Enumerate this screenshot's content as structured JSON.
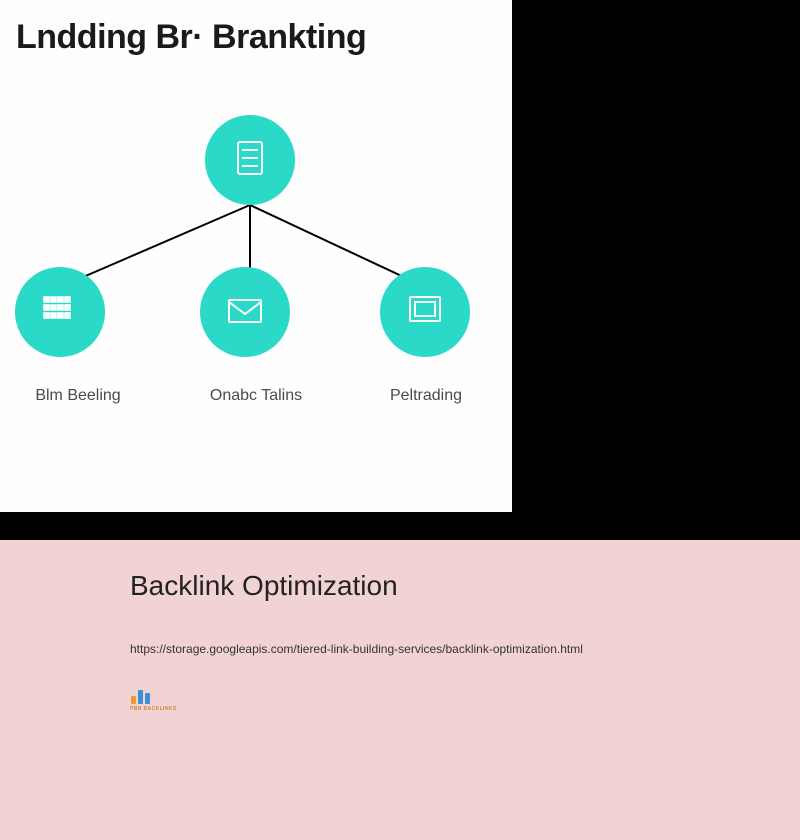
{
  "diagram": {
    "title": "Lndding Br· Brankting",
    "nodes": {
      "top": {
        "icon": "database"
      },
      "left": {
        "icon": "grid-code",
        "label": "Blm Beeling"
      },
      "middle": {
        "icon": "envelope",
        "label": "Onabc Talins"
      },
      "right": {
        "icon": "monitor",
        "label": "Peltrading"
      }
    }
  },
  "card": {
    "title": "Backlink Optimization",
    "url": "https://storage.googleapis.com/tiered-link-building-services/backlink-optimization.html",
    "logo_text": "PBN BACKLINKS"
  },
  "colors": {
    "node": "#2ad9c7",
    "card_bg": "#f2d3d4"
  }
}
